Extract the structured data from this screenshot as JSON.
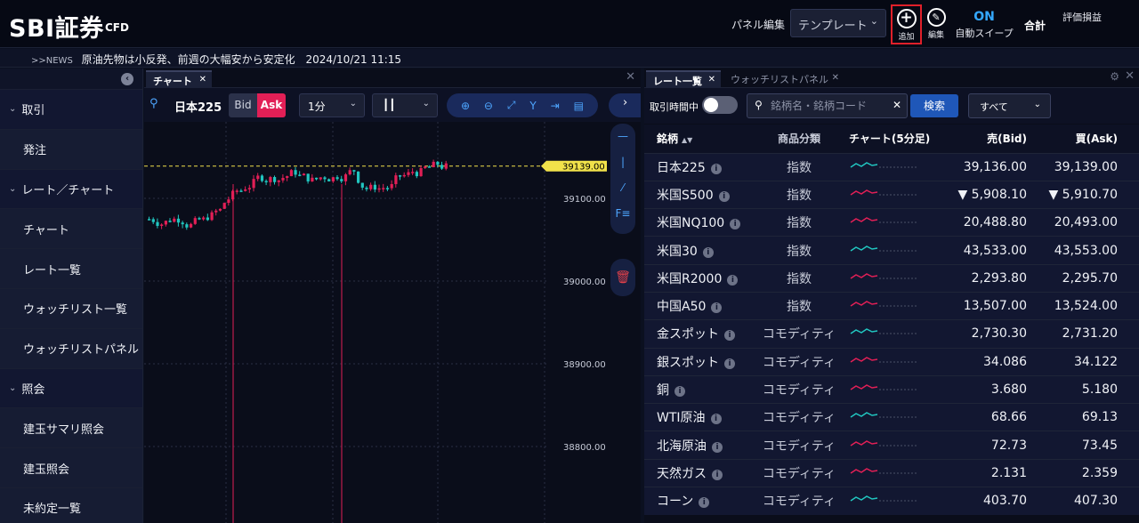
{
  "header": {
    "logo": "SBI証券",
    "logo_sub": "CFD",
    "panel_edit_label": "パネル編集",
    "template_select": "テンプレート",
    "add_label": "追加",
    "edit_label": "編集",
    "auto_sweep_state": "ON",
    "auto_sweep_label": "自動スイープ",
    "total_label": "合計",
    "pnl_label": "評価損益"
  },
  "news": {
    "tag": ">>NEWS",
    "headline": "原油先物は小反発、前週の大幅安から安定化",
    "time": "2024/10/21 11:15"
  },
  "sidebar": {
    "items": [
      {
        "label": "取引",
        "section": true
      },
      {
        "label": "発注",
        "section": false
      },
      {
        "label": "レート／チャート",
        "section": true
      },
      {
        "label": "チャート",
        "section": false
      },
      {
        "label": "レート一覧",
        "section": false
      },
      {
        "label": "ウォッチリスト一覧",
        "section": false
      },
      {
        "label": "ウォッチリストパネル",
        "section": false
      },
      {
        "label": "照会",
        "section": true
      },
      {
        "label": "建玉サマリ照会",
        "section": false
      },
      {
        "label": "建玉照会",
        "section": false
      },
      {
        "label": "未約定一覧",
        "section": false
      }
    ]
  },
  "chart_panel": {
    "tab_label": "チャート",
    "symbol": "日本225",
    "bid_label": "Bid",
    "ask_label": "Ask",
    "interval": "1分",
    "price_tag": "39139.00",
    "axis_labels": [
      "39100.00",
      "39000.00",
      "38900.00",
      "38800.00"
    ],
    "colors": {
      "up": "#e21f56",
      "down": "#21c6c0",
      "price_line": "#f1e24a"
    }
  },
  "rate_panel": {
    "tabs": [
      "レート一覧",
      "ウォッチリストパネル"
    ],
    "after_hours_label": "取引時間中",
    "search_placeholder": "銘柄名・銘柄コード",
    "search_button": "検索",
    "filter": "すべて",
    "columns": {
      "name": "銘柄",
      "category": "商品分類",
      "chart": "チャート(5分足)",
      "bid": "売(Bid)",
      "ask": "買(Ask)"
    },
    "rows": [
      {
        "name": "日本225",
        "category": "指数",
        "bid": "39,136.00",
        "ask": "39,139.00",
        "down": false
      },
      {
        "name": "米国S500",
        "category": "指数",
        "bid": "▼ 5,908.10",
        "ask": "▼ 5,910.70",
        "down": true
      },
      {
        "name": "米国NQ100",
        "category": "指数",
        "bid": "20,488.80",
        "ask": "20,493.00",
        "down": false
      },
      {
        "name": "米国30",
        "category": "指数",
        "bid": "43,533.00",
        "ask": "43,553.00",
        "down": false
      },
      {
        "name": "米国R2000",
        "category": "指数",
        "bid": "2,293.80",
        "ask": "2,295.70",
        "down": false
      },
      {
        "name": "中国A50",
        "category": "指数",
        "bid": "13,507.00",
        "ask": "13,524.00",
        "down": false
      },
      {
        "name": "金スポット",
        "category": "コモディティ",
        "bid": "2,730.30",
        "ask": "2,731.20",
        "down": false
      },
      {
        "name": "銀スポット",
        "category": "コモディティ",
        "bid": "34.086",
        "ask": "34.122",
        "down": false
      },
      {
        "name": "銅",
        "category": "コモディティ",
        "bid": "3.680",
        "ask": "5.180",
        "down": false
      },
      {
        "name": "WTI原油",
        "category": "コモディティ",
        "bid": "68.66",
        "ask": "69.13",
        "down": false
      },
      {
        "name": "北海原油",
        "category": "コモディティ",
        "bid": "72.73",
        "ask": "73.45",
        "down": false
      },
      {
        "name": "天然ガス",
        "category": "コモディティ",
        "bid": "2.131",
        "ask": "2.359",
        "down": false
      },
      {
        "name": "コーン",
        "category": "コモディティ",
        "bid": "403.70",
        "ask": "407.30",
        "down": false
      }
    ]
  }
}
